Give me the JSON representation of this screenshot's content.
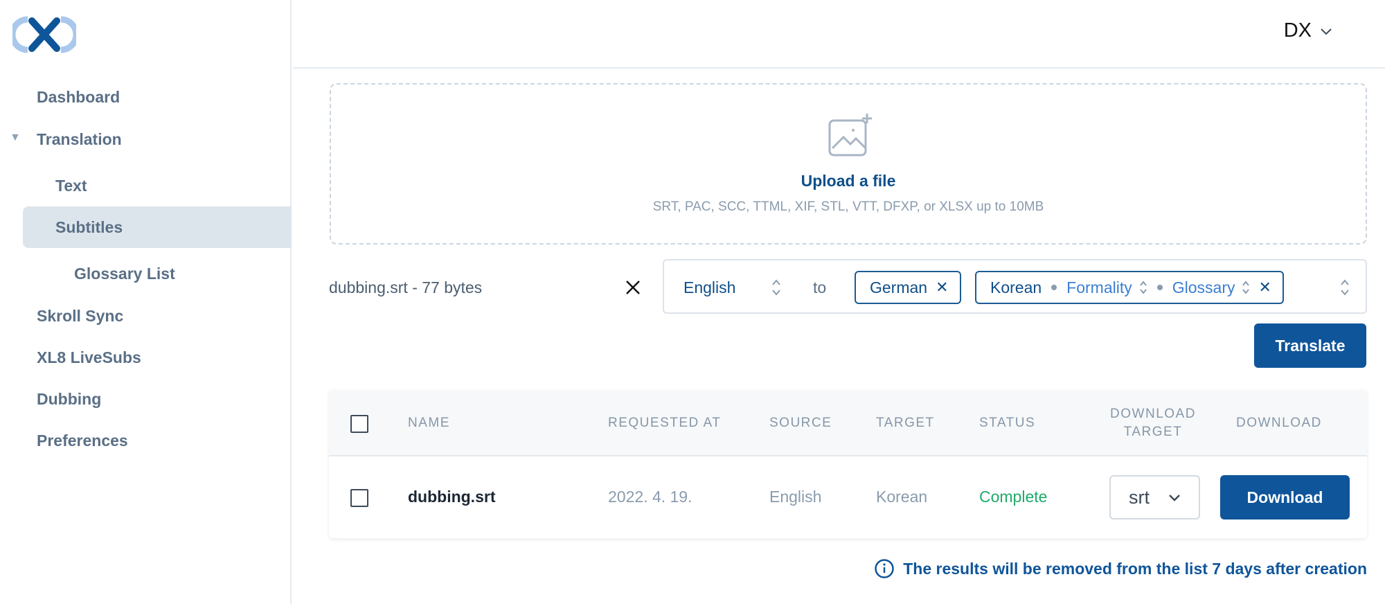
{
  "sidebar": {
    "logo_icon": "xl8-logo",
    "items": [
      {
        "label": "Dashboard"
      },
      {
        "label": "Translation",
        "expanded": true
      },
      {
        "label": "Text"
      },
      {
        "label": "Subtitles",
        "active": true
      },
      {
        "label": "Glossary List"
      },
      {
        "label": "Skroll Sync"
      },
      {
        "label": "XL8 LiveSubs"
      },
      {
        "label": "Dubbing"
      },
      {
        "label": "Preferences"
      }
    ]
  },
  "header": {
    "user_initials": "DX",
    "user_menu_icon": "chevron-down-icon"
  },
  "upload": {
    "icon": "image-add-icon",
    "link_label": "Upload a file",
    "hint": "SRT, PAC, SCC, TTML, XIF, STL, VTT, DFXP, or XLSX up to 10MB"
  },
  "file": {
    "name": "dubbing.srt - 77 bytes",
    "remove_icon": "close-icon"
  },
  "languages": {
    "source": "English",
    "to_label": "to",
    "targets": [
      {
        "label": "German"
      },
      {
        "label": "Korean",
        "formality_label": "Formality",
        "glossary_label": "Glossary"
      }
    ]
  },
  "actions": {
    "translate_label": "Translate"
  },
  "table": {
    "headers": {
      "name": "NAME",
      "requested_at": "REQUESTED AT",
      "source": "SOURCE",
      "target": "TARGET",
      "status": "STATUS",
      "download_target_1": "DOWNLOAD",
      "download_target_2": "TARGET",
      "download": "DOWNLOAD"
    },
    "rows": [
      {
        "name": "dubbing.srt",
        "requested_at": "2022. 4. 19.",
        "source": "English",
        "target": "Korean",
        "status": "Complete",
        "download_target": "srt",
        "download_label": "Download"
      }
    ]
  },
  "notice": {
    "icon": "info-icon",
    "text": "The results will be removed from the list 7 days after creation"
  },
  "colors": {
    "primary": "#0f559a",
    "status_complete": "#1faa6a",
    "sidebar_active": "#dde5ec"
  }
}
